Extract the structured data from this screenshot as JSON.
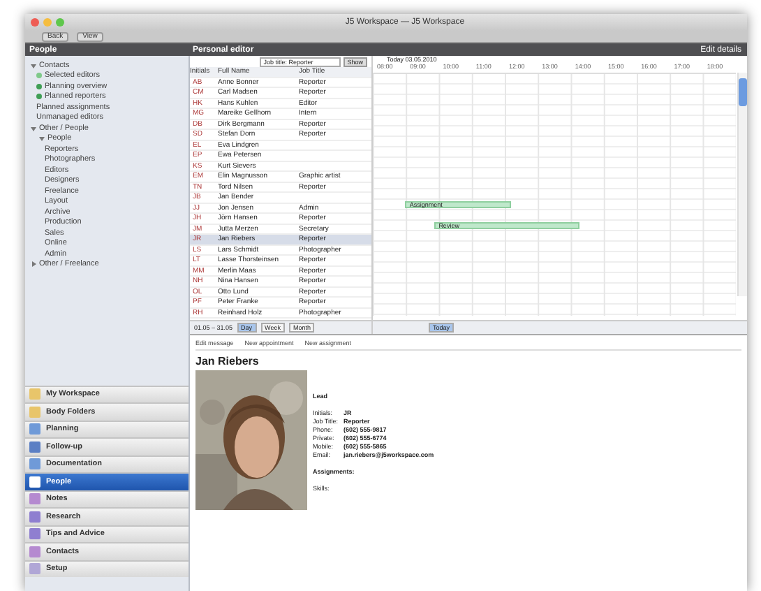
{
  "window": {
    "title": "J5 Workspace — J5 Workspace"
  },
  "toolbar": {
    "items": [
      "Back",
      "View"
    ]
  },
  "header": {
    "left": "People",
    "center": "Personal editor",
    "right": "Edit details"
  },
  "tree": [
    {
      "label": "Contacts",
      "expanded": true,
      "children": [
        {
          "label": "Selected editors",
          "color": "#7fc98a"
        },
        {
          "label": "Planning overview",
          "color": "#3f9e55"
        },
        {
          "label": "Planned reporters",
          "color": "#3f9e55"
        },
        {
          "label": "Planned assignments"
        },
        {
          "label": "Unmanaged editors"
        }
      ]
    },
    {
      "label": "Other / People",
      "expanded": true,
      "children": [
        {
          "label": "People",
          "expanded": true,
          "children": [
            {
              "label": "Reporters"
            },
            {
              "label": "Photographers"
            },
            {
              "label": "Editors"
            },
            {
              "label": "Designers"
            },
            {
              "label": "Freelance"
            },
            {
              "label": "Layout"
            },
            {
              "label": "Archive"
            },
            {
              "label": "Production"
            },
            {
              "label": "Sales"
            },
            {
              "label": "Online"
            },
            {
              "label": "Admin"
            }
          ]
        }
      ]
    },
    {
      "label": "Other / Freelance",
      "expanded": false
    }
  ],
  "nav": [
    {
      "label": "My Workspace",
      "color": "#e8c56a",
      "selected": false
    },
    {
      "label": "Body Folders",
      "color": "#e8c56a",
      "selected": false
    },
    {
      "label": "Planning",
      "color": "#6f9ad8",
      "selected": false
    },
    {
      "label": "Follow-up",
      "color": "#5b7fc4",
      "selected": false
    },
    {
      "label": "Documentation",
      "color": "#6f9ad8",
      "selected": false
    },
    {
      "label": "People",
      "color": "#ffffff",
      "selected": true
    },
    {
      "label": "Notes",
      "color": "#b58ad0",
      "selected": false
    },
    {
      "label": "Research",
      "color": "#8f7fd0",
      "selected": false
    },
    {
      "label": "Tips and Advice",
      "color": "#8f7fd0",
      "selected": false
    },
    {
      "label": "Contacts",
      "color": "#b58ad0",
      "selected": false
    },
    {
      "label": "Setup",
      "color": "#b0a6d6",
      "selected": false
    }
  ],
  "filter": {
    "value": "Job title: Reporter",
    "button": "Show"
  },
  "table": {
    "columns": [
      "Initials",
      "Full Name",
      "Job Title"
    ],
    "rows": [
      {
        "initials": "AB",
        "name": "Anne Bonner",
        "job": "Reporter",
        "selected": false
      },
      {
        "initials": "CM",
        "name": "Carl Madsen",
        "job": "Reporter",
        "selected": false
      },
      {
        "initials": "HK",
        "name": "Hans Kuhlen",
        "job": "Editor",
        "selected": false
      },
      {
        "initials": "MG",
        "name": "Mareike Gellhorn",
        "job": "Intern",
        "selected": false
      },
      {
        "initials": "DB",
        "name": "Dirk Bergmann",
        "job": "Reporter",
        "selected": false
      },
      {
        "initials": "SD",
        "name": "Stefan Dorn",
        "job": "Reporter",
        "selected": false
      },
      {
        "initials": "EL",
        "name": "Eva Lindgren",
        "selected": false
      },
      {
        "initials": "EP",
        "name": "Ewa Petersen",
        "selected": false
      },
      {
        "initials": "KS",
        "name": "Kurt Sievers",
        "selected": false
      },
      {
        "initials": "EM",
        "name": "Elin Magnusson",
        "job": "Graphic artist",
        "selected": false
      },
      {
        "initials": "TN",
        "name": "Tord Nilsen",
        "job": "Reporter",
        "selected": false
      },
      {
        "initials": "JB",
        "name": "Jan Bender",
        "selected": false
      },
      {
        "initials": "JJ",
        "name": "Jon Jensen",
        "job": "Admin",
        "selected": false,
        "bar": {
          "label": "Assignment"
        }
      },
      {
        "initials": "JH",
        "name": "Jörn Hansen",
        "job": "Reporter",
        "selected": false
      },
      {
        "initials": "JM",
        "name": "Jutta Merzen",
        "job": "Secretary",
        "selected": false,
        "bar": {
          "label": "Review"
        }
      },
      {
        "initials": "JR",
        "name": "Jan Riebers",
        "job": "Reporter",
        "selected": true
      },
      {
        "initials": "LS",
        "name": "Lars Schmidt",
        "job": "Photographer",
        "selected": false
      },
      {
        "initials": "LT",
        "name": "Lasse Thorsteinsen",
        "job": "Reporter",
        "selected": false
      },
      {
        "initials": "MM",
        "name": "Merlin Maas",
        "job": "Reporter",
        "selected": false
      },
      {
        "initials": "NH",
        "name": "Nina Hansen",
        "job": "Reporter",
        "selected": false
      },
      {
        "initials": "OL",
        "name": "Otto Lund",
        "job": "Reporter",
        "selected": false
      },
      {
        "initials": "PF",
        "name": "Peter Franke",
        "job": "Reporter",
        "selected": false
      },
      {
        "initials": "RH",
        "name": "Reinhard Holz",
        "job": "Photographer",
        "selected": false
      }
    ]
  },
  "pager": {
    "range": "01.05 – 31.05",
    "buttons": [
      {
        "label": "Day",
        "selected": true
      },
      {
        "label": "Week",
        "selected": false
      },
      {
        "label": "Month",
        "selected": false
      }
    ]
  },
  "timeline": {
    "date": "Today 03.05.2010",
    "hours": [
      "08:00",
      "09:00",
      "10:00",
      "11:00",
      "12:00",
      "13:00",
      "14:00",
      "15:00",
      "16:00",
      "17:00",
      "18:00"
    ],
    "today_button": "Today"
  },
  "actions": [
    "Edit message",
    "New appointment",
    "New assignment"
  ],
  "person": {
    "name": "Jan Riebers",
    "status": "Lead",
    "fields": [
      {
        "label": "Initials:",
        "value": "JR"
      },
      {
        "label": "Job Title:",
        "value": "Reporter"
      },
      {
        "label": "Phone:",
        "value": "(602) 555-9817"
      },
      {
        "label": "Private:",
        "value": "(602) 555-6774"
      },
      {
        "label": "Mobile:",
        "value": "(602) 555-5865"
      },
      {
        "label": "Email:",
        "value": "jan.riebers@j5workspace.com"
      }
    ],
    "assignments": "Assignments:",
    "skills": "Skills:"
  }
}
